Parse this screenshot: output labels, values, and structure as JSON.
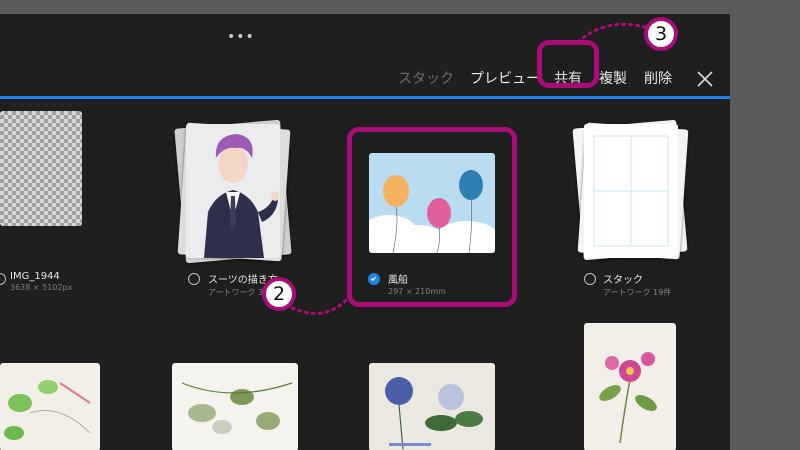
{
  "toolbar": {
    "stack_label": "スタック",
    "preview_label": "プレビュー",
    "share_label": "共有",
    "duplicate_label": "複製",
    "delete_label": "削除"
  },
  "gallery": {
    "items": [
      {
        "title": "IMG_1944",
        "subtitle": "3638 × 5102px",
        "selected": false
      },
      {
        "title": "スーツの描き方",
        "subtitle": "アートワーク 38件",
        "selected": false
      },
      {
        "title": "風船",
        "subtitle": "297 × 210mm",
        "selected": true
      },
      {
        "title": "スタック",
        "subtitle": "アートワーク 19件",
        "selected": false
      }
    ]
  },
  "annotations": {
    "step2": "2",
    "step3": "3",
    "highlight_color": "#a80d78"
  },
  "colors": {
    "accent": "#1e82e6",
    "background": "#1f1f1f"
  }
}
